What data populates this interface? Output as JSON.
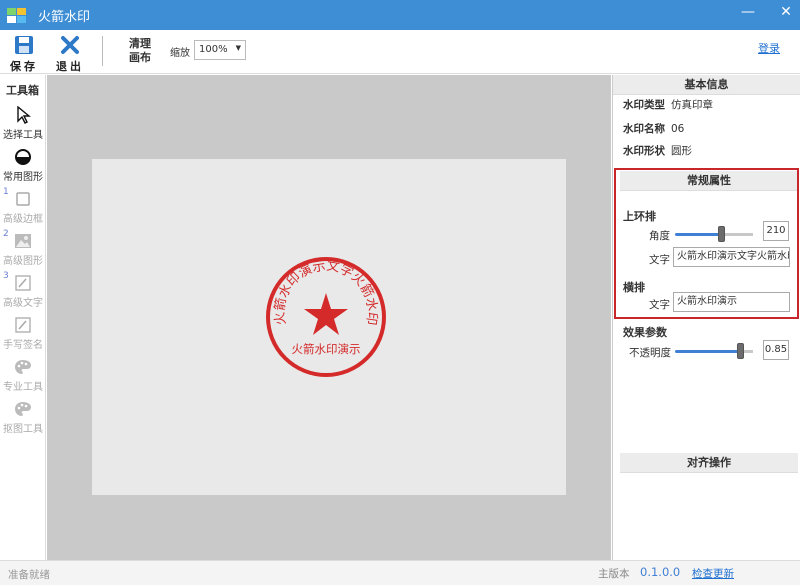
{
  "window": {
    "title": "火箭水印",
    "minimize": "—",
    "close": "✕"
  },
  "toolbar": {
    "save_label": "保存",
    "exit_label": "退出",
    "clear_canvas_line1": "清理",
    "clear_canvas_line2": "画布",
    "zoom_label": "缩放",
    "zoom_value": "100%",
    "login_label": "登录"
  },
  "sidebar": {
    "title": "工具箱",
    "items": [
      {
        "label": "选择工具",
        "icon": "cursor-icon",
        "num": ""
      },
      {
        "label": "常用图形",
        "icon": "circle-shape-icon",
        "num": ""
      },
      {
        "label": "高级边框",
        "icon": "square-border-icon",
        "num": "1"
      },
      {
        "label": "高级图形",
        "icon": "image-icon",
        "num": "2"
      },
      {
        "label": "高级文字",
        "icon": "pen-text-icon",
        "num": "3"
      },
      {
        "label": "手写签名",
        "icon": "signature-icon",
        "num": ""
      },
      {
        "label": "专业工具",
        "icon": "palette-icon",
        "num": ""
      },
      {
        "label": "抠图工具",
        "icon": "palette-icon",
        "num": ""
      }
    ]
  },
  "seal": {
    "arc_text": "火箭水印演示文字火箭水印",
    "bottom_text": "火箭水印演示",
    "color": "#d42a2a"
  },
  "panel": {
    "basic_info": {
      "title": "基本信息",
      "rows": [
        {
          "key": "水印类型",
          "value": "仿真印章"
        },
        {
          "key": "水印名称",
          "value": "06"
        },
        {
          "key": "水印形状",
          "value": "圆形"
        }
      ]
    },
    "general": {
      "title": "常规属性",
      "upper_arc": {
        "title": "上环排",
        "angle_label": "角度",
        "angle_value": "210",
        "angle_fraction": 0.6,
        "text_label": "文字",
        "text_value": "火箭水印演示文字火箭水印"
      },
      "horizontal": {
        "title": "横排",
        "text_label": "文字",
        "text_value": "火箭水印演示"
      }
    },
    "effects": {
      "title": "效果参数",
      "opacity_label": "不透明度",
      "opacity_value": "0.85",
      "opacity_fraction": 0.85
    },
    "align": {
      "title": "对齐操作"
    }
  },
  "status": {
    "left": "准备就绪",
    "version_label": "主版本",
    "version_value": "0.1.0.0",
    "update_label": "检查更新"
  },
  "colors": {
    "titlebar": "#3e8ed6",
    "accent": "#3f7fd4",
    "highlight_box": "#c8262b"
  }
}
